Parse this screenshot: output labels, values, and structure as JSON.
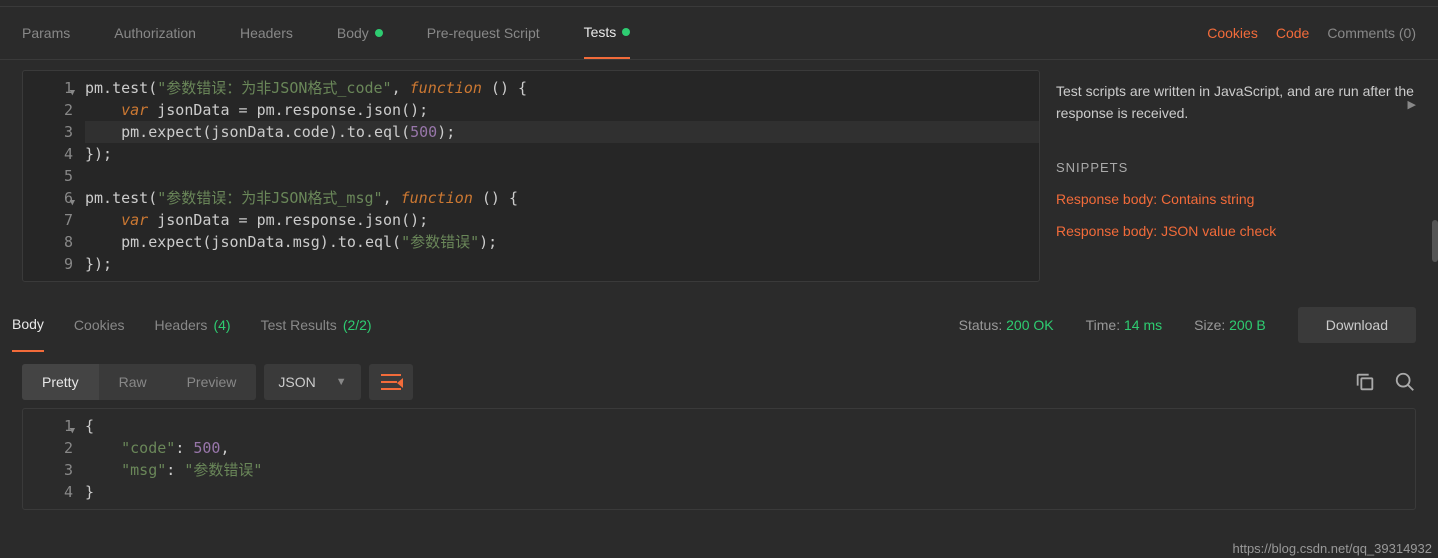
{
  "topTabs": {
    "params": "Params",
    "authorization": "Authorization",
    "headers": "Headers",
    "body": "Body",
    "prerequest": "Pre-request Script",
    "tests": "Tests"
  },
  "topLinks": {
    "cookies": "Cookies",
    "code": "Code",
    "comments": "Comments (0)"
  },
  "editor": {
    "lines": {
      "1a": "pm.test(",
      "1b": "\"参数错误：为非JSON格式_code\"",
      "1c": ", ",
      "1d": "function",
      "1e": " () {",
      "2a": "    ",
      "2b": "var",
      "2c": " jsonData = pm.response.json();",
      "3a": "    pm.expect(jsonData.code).to.eql(",
      "3b": "500",
      "3c": ");",
      "4": "});",
      "5": "",
      "6a": "pm.test(",
      "6b": "\"参数错误：为非JSON格式_msg\"",
      "6c": ", ",
      "6d": "function",
      "6e": " () {",
      "7a": "    ",
      "7b": "var",
      "7c": " jsonData = pm.response.json();",
      "8a": "    pm.expect(jsonData.msg).to.eql(",
      "8b": "\"参数错误\"",
      "8c": ");",
      "9": "});"
    },
    "gutter": [
      "1",
      "2",
      "3",
      "4",
      "5",
      "6",
      "7",
      "8",
      "9"
    ]
  },
  "side": {
    "info": "Test scripts are written in JavaScript, and are run after the response is received.",
    "snippetsLabel": "SNIPPETS",
    "s1": "Response body: Contains string",
    "s2": "Response body: JSON value check"
  },
  "respTabs": {
    "body": "Body",
    "cookies": "Cookies",
    "headers": "Headers",
    "headersCount": "(4)",
    "testResults": "Test Results",
    "testResultsCount": "(2/2)"
  },
  "status": {
    "statusLabel": "Status:",
    "statusVal": "200 OK",
    "timeLabel": "Time:",
    "timeVal": "14 ms",
    "sizeLabel": "Size:",
    "sizeVal": "200 B",
    "download": "Download"
  },
  "format": {
    "pretty": "Pretty",
    "raw": "Raw",
    "preview": "Preview",
    "json": "JSON"
  },
  "respEditor": {
    "gutter": [
      "1",
      "2",
      "3",
      "4"
    ],
    "l1": "{",
    "l2a": "    ",
    "l2b": "\"code\"",
    "l2c": ": ",
    "l2d": "500",
    "l2e": ",",
    "l3a": "    ",
    "l3b": "\"msg\"",
    "l3c": ": ",
    "l3d": "\"参数错误\"",
    "l4": "}"
  },
  "footer": {
    "url": "https://blog.csdn.net/qq_39314932"
  }
}
